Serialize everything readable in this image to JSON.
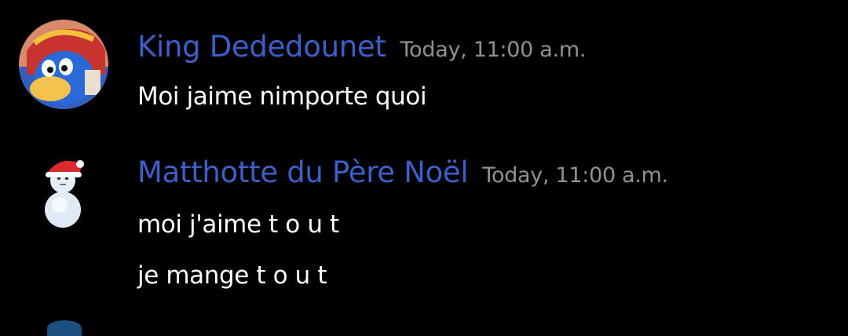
{
  "colors": {
    "background": "#000000",
    "username": "#3d5fc9",
    "timestamp": "#8e9297",
    "message_text": "#ffffff"
  },
  "messages": [
    {
      "author": "King Dededounet",
      "timestamp": "Today, 11:00 a.m.",
      "avatar_icon": "king-dedede-avatar-icon",
      "lines": [
        "Moi jaime nimporte quoi"
      ]
    },
    {
      "author": "Matthotte du Père Noël",
      "timestamp": "Today, 11:00 a.m.",
      "avatar_icon": "snowman-santa-hat-icon",
      "lines": [
        "moi j'aime t o u t",
        "je mange t o u t"
      ]
    }
  ]
}
